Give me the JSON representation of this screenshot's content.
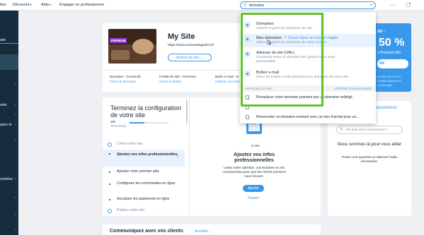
{
  "topbar": {
    "site_frag": "ites",
    "discover": "Découvrir",
    "help": "Aide",
    "engage": "Engager un professionnel",
    "search": {
      "query": "domaine"
    }
  },
  "sidebar": {
    "items": [
      {
        "label": "site"
      },
      {
        "label": "onts"
      },
      {
        "label": "ques et"
      },
      {
        "label": "contenu"
      }
    ]
  },
  "site_card": {
    "premium_badge": "PREMIUM",
    "title": "My Site",
    "url": "https://www.monwebsgastro.fr/",
    "actions_button": "Actions du site",
    "info": [
      {
        "label": "Domaine : Connecté",
        "link": "Gérer le domaine"
      },
      {
        "label": "Forfait du site : Premium",
        "link": "Gérer le forfait"
      },
      {
        "label": "Boîte e-mail : N",
        "link": "Obtenir une boît"
      }
    ]
  },
  "setup": {
    "title": "Terminez la configuration de votre site",
    "progress_count": "3/8",
    "progress_label": "Terminé(s)",
    "progress_fraction": 0.375,
    "items": [
      {
        "label": "Créez votre site"
      },
      {
        "label": "Ajoutez vos infos professionnelles"
      },
      {
        "label": "Ajoutez votre premier plat"
      },
      {
        "label": "Configurez les commandes en ligne"
      },
      {
        "label": "Acceptez les paiements en ligne"
      },
      {
        "label": "Publiez votre site"
      }
    ]
  },
  "detail": {
    "duration": "5 min",
    "title": "Ajoutez vos infos professionnelles",
    "desc": "Listez votre adresse, vos horaires et vos coordonnées pour que les clients puissent vous trouver.",
    "add_button": "Ajouter",
    "skip_link": "Passer"
  },
  "promo": {
    "frag_top": "ité -",
    "percent": "50 %",
    "frag_line": "s Premium Wix",
    "button_frag": "ite",
    "small_1": "rs 2021 (23:59 PT).",
    "small_2": "t forfait initialement",
    "small_3": "e promotion."
  },
  "help_panel": {
    "title": "d'assistance",
    "search_placeholder": "De quoi avez-vous besoin ?",
    "msg_title": "Nous sommes là pour vous aider",
    "msg_sub": "Posez une question et obtenez l'aide nécessaire."
  },
  "dropdown": {
    "results": [
      {
        "title": "Domaines",
        "desc": "Obtenir et gérer les domaines de site."
      },
      {
        "title": "Mes domaines",
        "ext": "Ouvrir dans un nouvel onglet",
        "desc": "Obtenir et gérer les domaines de votre compte"
      },
      {
        "title": "Adresse du site (URL)",
        "desc": "Choisissez entre un domaine Wix gratuit ou un autre",
        "desc2": "personnalisé."
      },
      {
        "title": "Boîtes e-mail",
        "desc": "Gérer les boîtes e-mail associées aux domaines de votre site."
      }
    ],
    "section_left": "ARTICLES D'AIDE",
    "section_right": "CENTRE D'ASSISTANCE",
    "articles": [
      {
        "label": "Remplacer votre domaine primaire par un domaine redirigé"
      },
      {
        "label": ""
      },
      {
        "label": "Renouveler un domaine existant avec un bon d'achat pour un..."
      }
    ]
  },
  "bottom": {
    "title_frag": "Communiquez avec vos clients",
    "link_frag": "Accéder..."
  },
  "colors": {
    "accent": "#3899ec",
    "highlight": "#5dc226",
    "sidebar": "#162d3d"
  }
}
